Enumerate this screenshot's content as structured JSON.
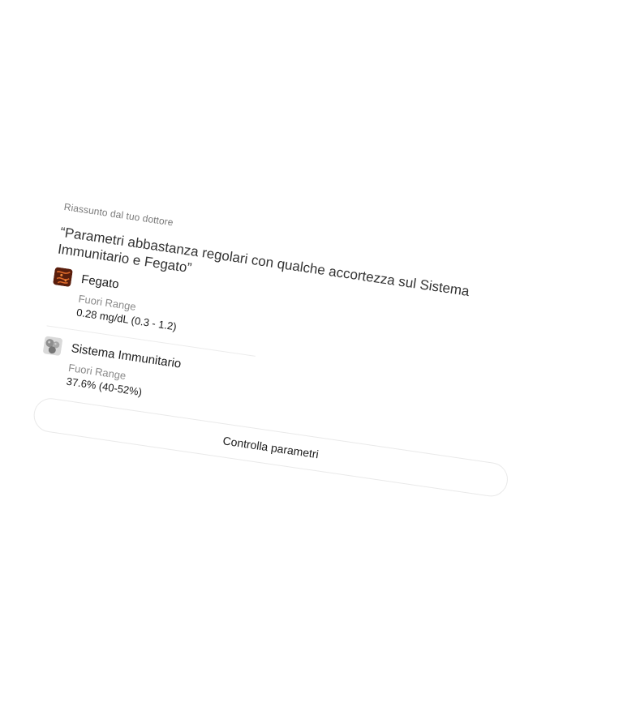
{
  "summary": {
    "label": "Riassunto dal tuo dottore",
    "quote": "“Parametri abbastanza regolari con qualche accortezza sul Sistema Immunitario e Fegato”"
  },
  "parameters": [
    {
      "name": "Fegato",
      "status": "Fuori Range",
      "value": "0.28 mg/dL (0.3 - 1.2)",
      "icon": "liver-icon"
    },
    {
      "name": "Sistema Immunitario",
      "status": "Fuori Range",
      "value": "37.6% (40-52%)",
      "icon": "immune-cells-icon"
    }
  ],
  "actions": {
    "check_button_label": "Controlla parametri"
  },
  "colors": {
    "text": "#1c1c1c",
    "muted": "#8b8b8b",
    "border": "#e9e9e9"
  }
}
